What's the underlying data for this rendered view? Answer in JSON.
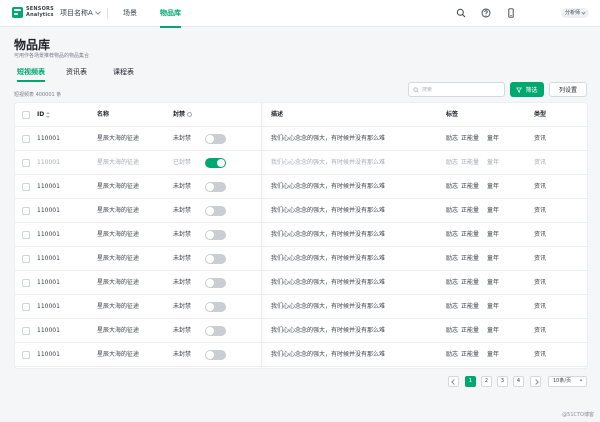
{
  "brand": {
    "line1": "SENSORS",
    "line2": "Analytics"
  },
  "topbar": {
    "project": "项目名称A",
    "nav": [
      "场景",
      "物品库"
    ],
    "active_nav": 1,
    "user": "分析师"
  },
  "page": {
    "title": "物品库",
    "description": "可用作各场景推荐物品的物品集合",
    "tabs": [
      "短视频表",
      "资讯表",
      "课程表"
    ],
    "active_tab": 0,
    "count": "短视频表 400001 条"
  },
  "toolbar": {
    "search_placeholder": "搜索",
    "filter_label": "筛选",
    "columns_label": "列设置"
  },
  "table": {
    "headers": {
      "id": "ID",
      "name": "名称",
      "locked": "封禁",
      "desc": "描述",
      "tags": "标签",
      "type": "类型"
    },
    "rows": [
      {
        "id": "110001",
        "name": "星辰大海的征途",
        "status": "未封禁",
        "locked": false,
        "desc": "我们心心念念的强大，有时候并没有那么难",
        "tags": [
          "励志",
          "正能量",
          "童年"
        ],
        "type": "资讯"
      },
      {
        "id": "110001",
        "name": "星辰大海的征途",
        "status": "已封禁",
        "locked": true,
        "desc": "我们心心念念的强大，有时候并没有那么难",
        "tags": [
          "励志",
          "正能量",
          "童年"
        ],
        "type": "资讯"
      },
      {
        "id": "110001",
        "name": "星辰大海的征途",
        "status": "未封禁",
        "locked": false,
        "desc": "我们心心念念的强大，有时候并没有那么难",
        "tags": [
          "励志",
          "正能量",
          "童年"
        ],
        "type": "资讯"
      },
      {
        "id": "110001",
        "name": "星辰大海的征途",
        "status": "未封禁",
        "locked": false,
        "desc": "我们心心念念的强大，有时候并没有那么难",
        "tags": [
          "励志",
          "正能量",
          "童年"
        ],
        "type": "资讯"
      },
      {
        "id": "110001",
        "name": "星辰大海的征途",
        "status": "未封禁",
        "locked": false,
        "desc": "我们心心念念的强大，有时候并没有那么难",
        "tags": [
          "励志",
          "正能量",
          "童年"
        ],
        "type": "资讯"
      },
      {
        "id": "110001",
        "name": "星辰大海的征途",
        "status": "未封禁",
        "locked": false,
        "desc": "我们心心念念的强大，有时候并没有那么难",
        "tags": [
          "励志",
          "正能量",
          "童年"
        ],
        "type": "资讯"
      },
      {
        "id": "110001",
        "name": "星辰大海的征途",
        "status": "未封禁",
        "locked": false,
        "desc": "我们心心念念的强大，有时候并没有那么难",
        "tags": [
          "励志",
          "正能量",
          "童年"
        ],
        "type": "资讯"
      },
      {
        "id": "110001",
        "name": "星辰大海的征途",
        "status": "未封禁",
        "locked": false,
        "desc": "我们心心念念的强大，有时候并没有那么难",
        "tags": [
          "励志",
          "正能量",
          "童年"
        ],
        "type": "资讯"
      },
      {
        "id": "110001",
        "name": "星辰大海的征途",
        "status": "未封禁",
        "locked": false,
        "desc": "我们心心念念的强大，有时候并没有那么难",
        "tags": [
          "励志",
          "正能量",
          "童年"
        ],
        "type": "资讯"
      },
      {
        "id": "110001",
        "name": "星辰大海的征途",
        "status": "未封禁",
        "locked": false,
        "desc": "我们心心念念的强大，有时候并没有那么难",
        "tags": [
          "励志",
          "正能量",
          "童年"
        ],
        "type": "资讯"
      }
    ]
  },
  "pagination": {
    "pages": [
      "1",
      "2",
      "3",
      "4"
    ],
    "current": "1",
    "page_size": "10条/页"
  },
  "watermark": "@51CTO博客",
  "colors": {
    "accent": "#00a870",
    "background": "#f5f6f8"
  },
  "icons": [
    "search-icon",
    "help-icon",
    "mobile-icon",
    "filter-icon"
  ]
}
